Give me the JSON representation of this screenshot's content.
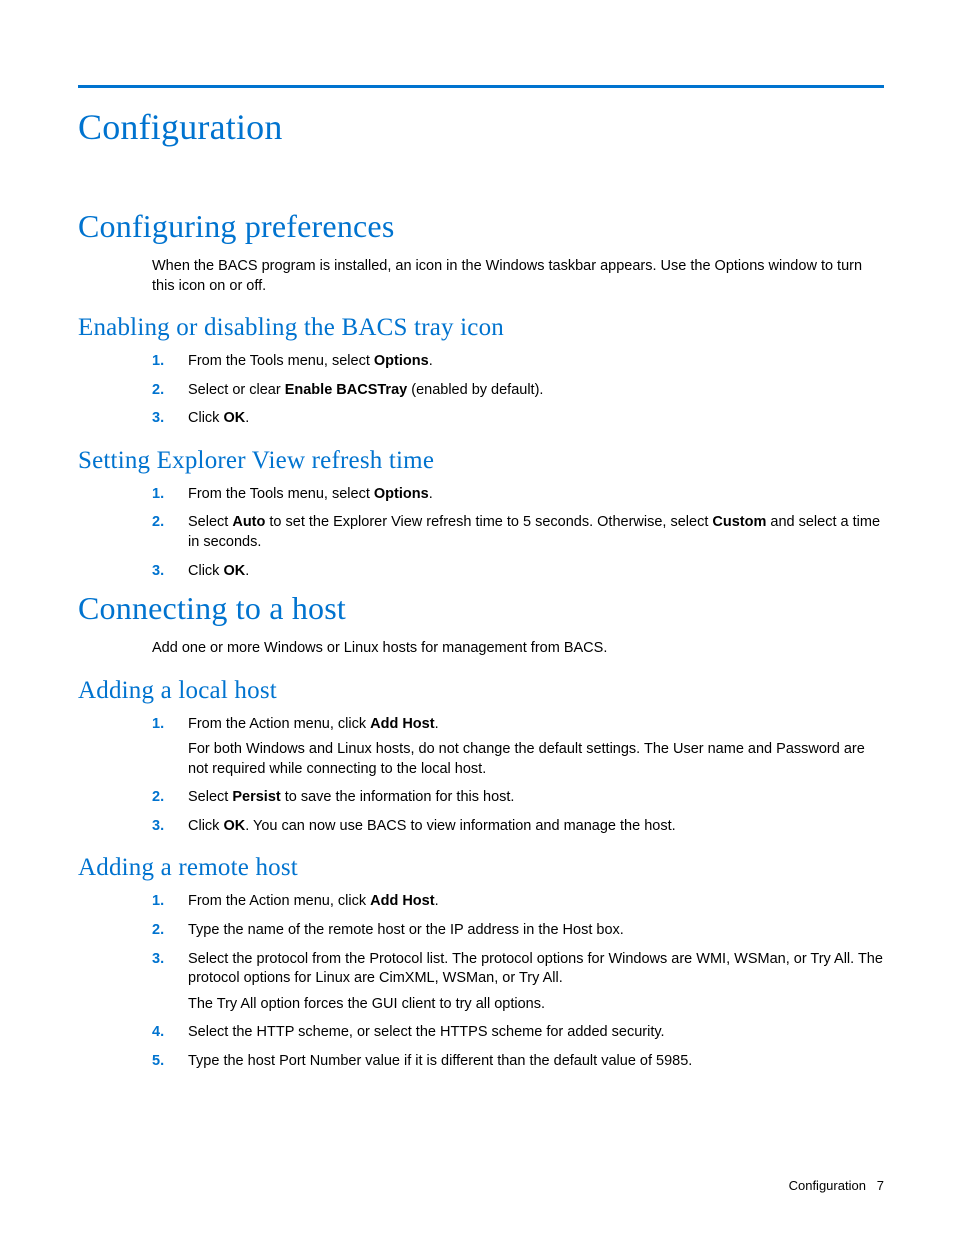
{
  "title": "Configuration",
  "footer": {
    "section": "Configuration",
    "page": "7"
  },
  "sections": [
    {
      "heading": "Configuring preferences",
      "intro": "When the BACS program is installed, an icon in the Windows taskbar appears. Use the Options window to turn this icon on or off.",
      "subs": [
        {
          "heading": "Enabling or disabling the BACS tray icon",
          "steps": [
            {
              "n": "1.",
              "pre": "From the Tools menu, select ",
              "bold": "Options",
              "post": "."
            },
            {
              "n": "2.",
              "pre": "Select or clear ",
              "bold": "Enable BACSTray",
              "post": " (enabled by default)."
            },
            {
              "n": "3.",
              "pre": "Click ",
              "bold": "OK",
              "post": "."
            }
          ]
        },
        {
          "heading": "Setting Explorer View refresh time",
          "steps": [
            {
              "n": "1.",
              "pre": "From the Tools menu, select ",
              "bold": "Options",
              "post": "."
            },
            {
              "n": "2.",
              "pre": "Select ",
              "bold": "Auto",
              "post": " to set the Explorer View refresh time to 5 seconds. Otherwise, select ",
              "bold2": "Custom",
              "post2": " and select a time in seconds."
            },
            {
              "n": "3.",
              "pre": "Click ",
              "bold": "OK",
              "post": "."
            }
          ]
        }
      ]
    },
    {
      "heading": "Connecting to a host",
      "intro": "Add one or more Windows or Linux hosts for management from BACS.",
      "subs": [
        {
          "heading": "Adding a local host",
          "steps": [
            {
              "n": "1.",
              "pre": "From the Action menu, click ",
              "bold": "Add Host",
              "post": ".",
              "extra": "For both Windows and Linux hosts, do not change the default settings. The User name and Password are not required while connecting to the local host."
            },
            {
              "n": "2.",
              "pre": "Select ",
              "bold": "Persist",
              "post": " to save the information for this host."
            },
            {
              "n": "3.",
              "pre": "Click ",
              "bold": "OK",
              "post": ". You can now use BACS to view information and manage the host."
            }
          ]
        },
        {
          "heading": "Adding a remote host",
          "steps": [
            {
              "n": "1.",
              "pre": "From the Action menu, click ",
              "bold": "Add Host",
              "post": "."
            },
            {
              "n": "2.",
              "plain": "Type the name of the remote host or the IP address in the Host box."
            },
            {
              "n": "3.",
              "plain": "Select the protocol from the Protocol list. The protocol options for Windows are WMI, WSMan, or Try All. The protocol options for Linux are CimXML, WSMan, or Try All.",
              "extra": "The Try All option forces the GUI client to try all options."
            },
            {
              "n": "4.",
              "plain": "Select the HTTP scheme, or select the HTTPS scheme for added security."
            },
            {
              "n": "5.",
              "plain": "Type the host Port Number value if it is different than the default value of 5985."
            }
          ]
        }
      ]
    }
  ]
}
